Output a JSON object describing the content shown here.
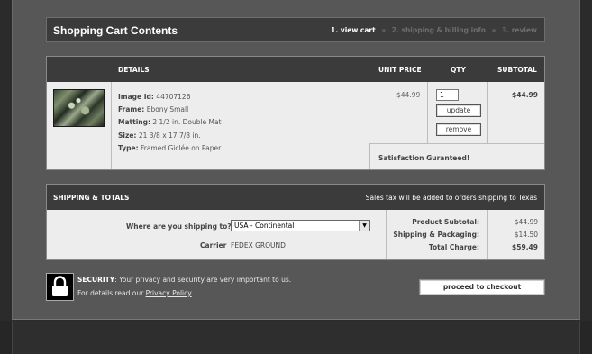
{
  "header": {
    "title": "Shopping Cart Contents",
    "steps": [
      "1. view cart",
      "2. shipping & billing info",
      "3. review"
    ],
    "step_separator": "»"
  },
  "cart": {
    "columns": [
      "DETAILS",
      "UNIT PRICE",
      "QTY",
      "SUBTOTAL"
    ],
    "item": {
      "thumbnail": "framed-giclee-thumbnail",
      "image_id_label": "Image Id:",
      "image_id": "44707126",
      "frame_label": "Frame:",
      "frame": "Ebony Small",
      "matting_label": "Matting:",
      "matting": "2 1/2 in. Double Mat",
      "size_label": "Size:",
      "size": "21 3/8 x 17 7/8 in.",
      "type_label": "Type:",
      "type": "Framed Giclée on Paper",
      "unit_price": "$44.99",
      "qty": "1",
      "update_label": "update",
      "remove_label": "remove",
      "subtotal": "$44.99"
    },
    "satisfaction": "Satisfaction Guranteed!"
  },
  "shipping": {
    "title": "SHIPPING & TOTALS",
    "tax_note": "Sales tax will be added to orders shipping to Texas",
    "question": "Where are you shipping to?",
    "destination_selected": "USA - Continental",
    "carrier_label": "Carrier",
    "carrier": "FEDEX GROUND",
    "totals": [
      {
        "label": "Product Subtotal:",
        "value": "$44.99"
      },
      {
        "label": "Shipping & Packaging:",
        "value": "$14.50"
      },
      {
        "label": "Total Charge:",
        "value": "$59.49"
      }
    ]
  },
  "security": {
    "icon": "lock-icon",
    "label": "SECURITY",
    "text": ": Your privacy and security are very important to us.",
    "details_prefix": "For details read our ",
    "privacy_link": "Privacy Policy"
  },
  "checkout_label": "proceed to checkout",
  "colors": {
    "header_bg": "#3b3b3b",
    "page_bg": "#575757",
    "panel_bg": "#ededed",
    "outer_bg": "#2b2b2b"
  }
}
